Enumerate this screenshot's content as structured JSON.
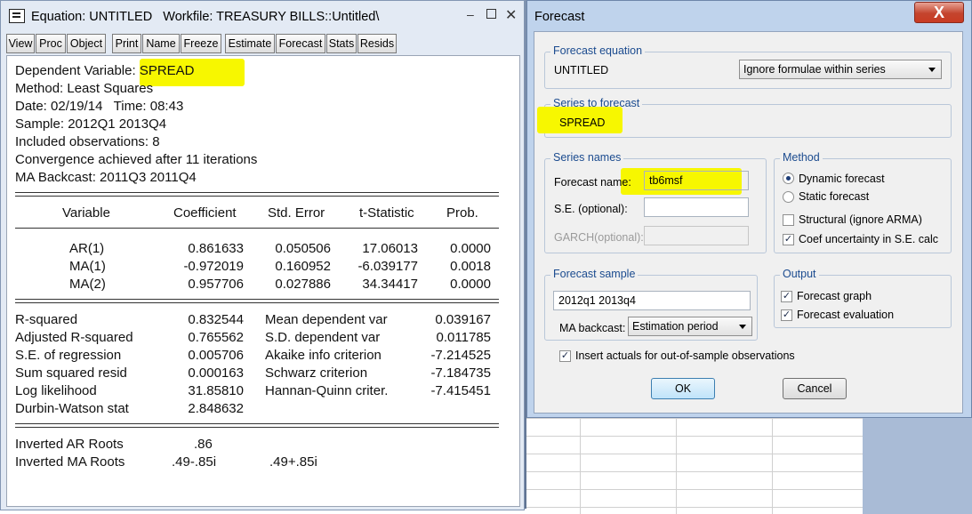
{
  "equation_window": {
    "title": "Equation: UNTITLED   Workfile: TREASURY BILLS::Untitled\\",
    "toolbar": [
      "View",
      "Proc",
      "Object",
      "Print",
      "Name",
      "Freeze",
      "Estimate",
      "Forecast",
      "Stats",
      "Resids"
    ],
    "header_lines": [
      "Dependent Variable: SPREAD",
      "Method: Least Squares",
      "Date: 02/19/14   Time: 08:43",
      "Sample: 2012Q1 2013Q4",
      "Included observations: 8",
      "Convergence achieved after 11 iterations",
      "MA Backcast: 2011Q3 2011Q4"
    ],
    "coef_table": {
      "columns": [
        "Variable",
        "Coefficient",
        "Std. Error",
        "t-Statistic",
        "Prob."
      ],
      "rows": [
        [
          "AR(1)",
          "0.861633",
          "0.050506",
          "17.06013",
          "0.0000"
        ],
        [
          "MA(1)",
          "-0.972019",
          "0.160952",
          "-6.039177",
          "0.0018"
        ],
        [
          "MA(2)",
          "0.957706",
          "0.027886",
          "34.34417",
          "0.0000"
        ]
      ]
    },
    "stats": [
      [
        "R-squared",
        "0.832544",
        "Mean dependent var",
        "0.039167"
      ],
      [
        "Adjusted R-squared",
        "0.765562",
        "S.D. dependent var",
        "0.011785"
      ],
      [
        "S.E. of regression",
        "0.005706",
        "Akaike info criterion",
        "-7.214525"
      ],
      [
        "Sum squared resid",
        "0.000163",
        "Schwarz criterion",
        "-7.184735"
      ],
      [
        "Log likelihood",
        "31.85810",
        "Hannan-Quinn criter.",
        "-7.415451"
      ],
      [
        "Durbin-Watson stat",
        "2.848632",
        "",
        ""
      ]
    ],
    "roots": [
      [
        "Inverted AR Roots",
        ".86",
        ""
      ],
      [
        "Inverted MA Roots",
        ".49-.85i",
        ".49+.85i"
      ]
    ]
  },
  "forecast_dialog": {
    "title": "Forecast",
    "close_label": "X",
    "forecast_equation": {
      "label": "Forecast equation",
      "name": "UNTITLED",
      "formula_option": "Ignore formulae within series"
    },
    "series_to_forecast": {
      "label": "Series to forecast",
      "value": "SPREAD"
    },
    "series_names": {
      "label": "Series names",
      "forecast_name_label": "Forecast name:",
      "forecast_name_value": "tb6msf",
      "se_label": "S.E. (optional):",
      "se_value": "",
      "garch_label": "GARCH(optional):",
      "garch_value": ""
    },
    "method": {
      "label": "Method",
      "dynamic": "Dynamic forecast",
      "static": "Static forecast",
      "structural": "Structural (ignore ARMA)",
      "coef_uncertainty": "Coef uncertainty in S.E. calc",
      "selected": "dynamic",
      "structural_checked": false,
      "coef_uncertainty_checked": true
    },
    "forecast_sample": {
      "label": "Forecast sample",
      "value": "2012q1 2013q4",
      "ma_backcast_label": "MA backcast:",
      "ma_backcast_value": "Estimation period"
    },
    "output": {
      "label": "Output",
      "graph": "Forecast graph",
      "evaluation": "Forecast evaluation",
      "graph_checked": true,
      "evaluation_checked": true
    },
    "insert_actuals_label": "Insert actuals for out-of-sample observations",
    "insert_actuals_checked": true,
    "ok_label": "OK",
    "cancel_label": "Cancel"
  },
  "colors": {
    "highlight": "#f7f700",
    "group_label": "#1b4b8f",
    "close_button": "#c83b22"
  }
}
